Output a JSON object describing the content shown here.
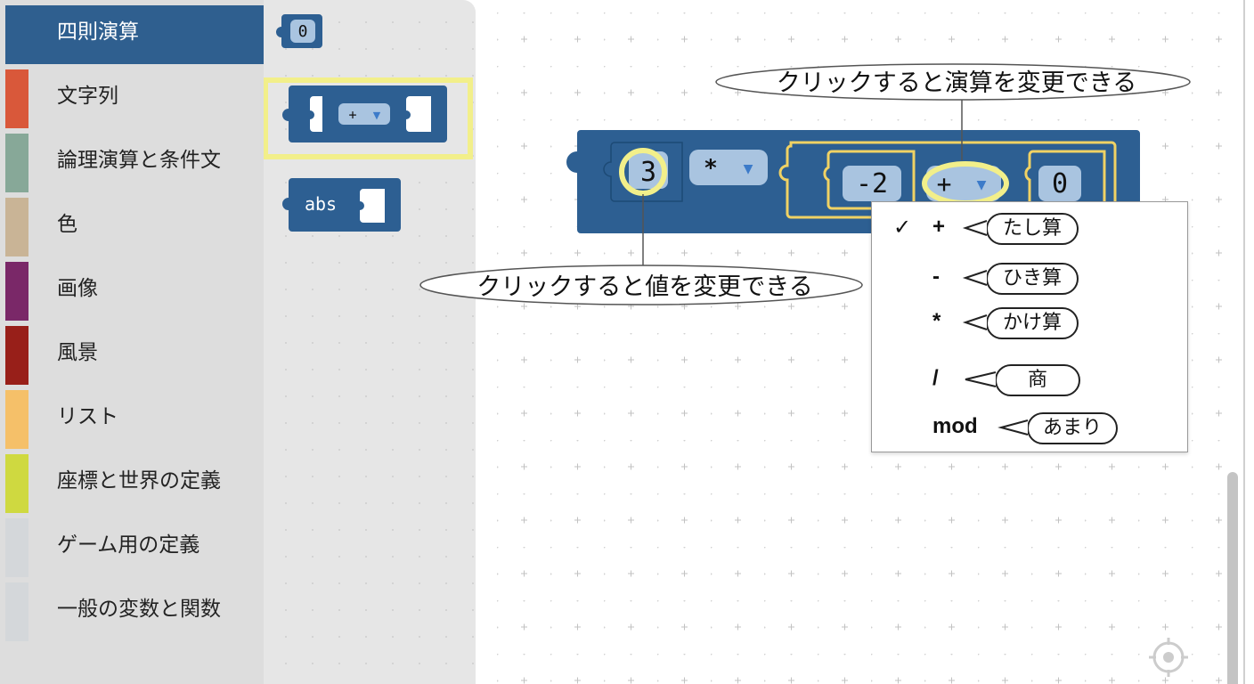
{
  "toolbox": {
    "categories": [
      {
        "label": "四則演算",
        "color": "#2f5f8f",
        "selected": true
      },
      {
        "label": "文字列",
        "color": "#d9583a"
      },
      {
        "label": "論理演算と条件文",
        "color": "#87a898"
      },
      {
        "label": "色",
        "color": "#c9b496"
      },
      {
        "label": "画像",
        "color": "#7a2868"
      },
      {
        "label": "風景",
        "color": "#981f19"
      },
      {
        "label": "リスト",
        "color": "#f5c069"
      },
      {
        "label": "座標と世界の定義",
        "color": "#cfd940"
      },
      {
        "label": "ゲーム用の定義",
        "color": "#d4d7da"
      },
      {
        "label": "一般の変数と関数",
        "color": "#d4d7da"
      }
    ]
  },
  "flyout": {
    "number_block": {
      "value": "0"
    },
    "arith_block": {
      "operator": "+"
    },
    "abs_block": {
      "label": "abs"
    }
  },
  "workspace": {
    "main_block": {
      "left_value": "3",
      "outer_operator": "*",
      "inner_left_value": "-2",
      "inner_operator": "+",
      "inner_right_value": "0"
    },
    "callouts": {
      "operator_hint": "クリックすると演算を変更できる",
      "value_hint": "クリックすると値を変更できる"
    },
    "dropdown": {
      "checkmark": "✓",
      "items": [
        {
          "label": "+",
          "note": "たし算",
          "checked": true
        },
        {
          "label": "-",
          "note": "ひき算",
          "checked": false
        },
        {
          "label": "*",
          "note": "かけ算",
          "checked": false
        },
        {
          "label": "/",
          "note": "商",
          "checked": false
        },
        {
          "label": "mod",
          "note": "あまり",
          "checked": false
        }
      ]
    }
  },
  "colors": {
    "block": "#2d5f92",
    "field": "#a9c4e0",
    "highlight": "#f2ef8a",
    "inner_outline": "#f0d264"
  },
  "icons": {
    "dropdown_arrow": "triangle-down-icon",
    "recenter": "crosshair-icon"
  }
}
